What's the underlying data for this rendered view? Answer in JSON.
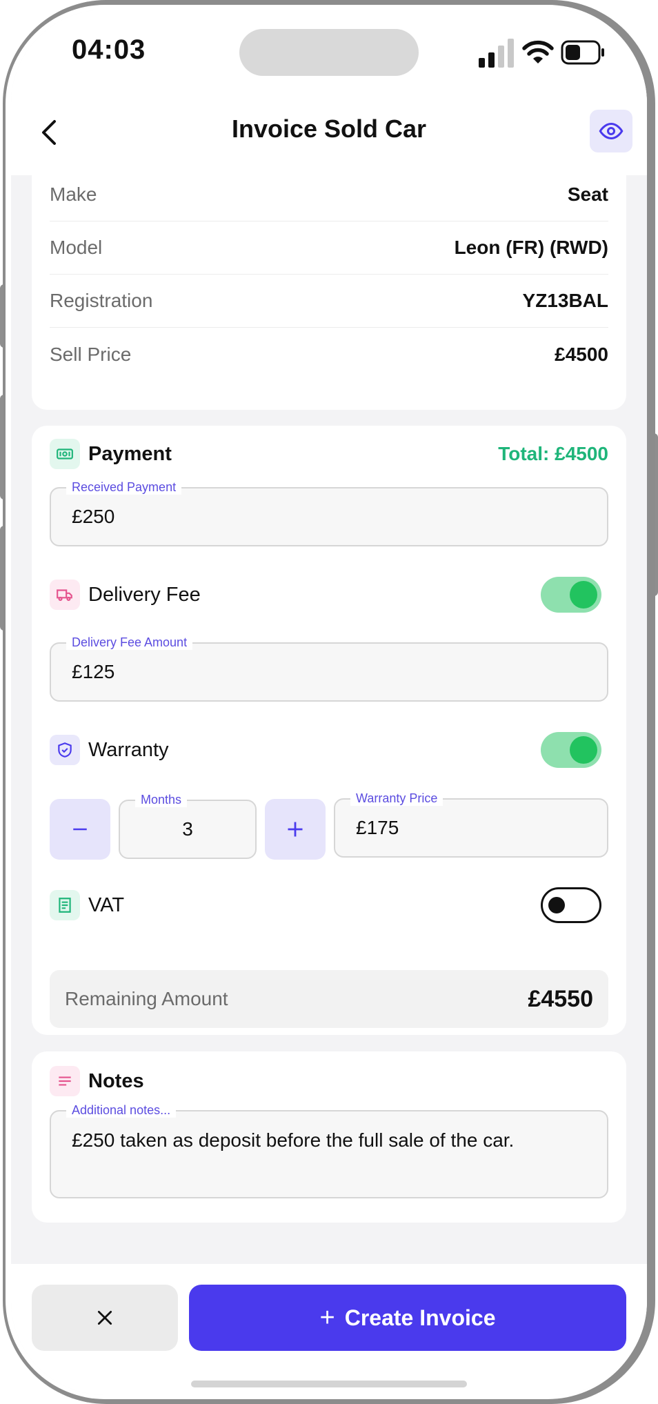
{
  "status_bar": {
    "time": "04:03"
  },
  "header": {
    "title": "Invoice Sold Car"
  },
  "car_info": [
    {
      "label": "Make",
      "value": "Seat"
    },
    {
      "label": "Model",
      "value": "Leon (FR) (RWD)"
    },
    {
      "label": "Registration",
      "value": "YZ13BAL"
    },
    {
      "label": "Sell Price",
      "value": "£4500"
    }
  ],
  "payment": {
    "label": "Payment",
    "total": "Total: £4500",
    "received_label": "Received Payment",
    "received_value": "£250"
  },
  "delivery": {
    "label": "Delivery Fee",
    "enabled": true,
    "amount_label": "Delivery Fee Amount",
    "amount_value": "£125"
  },
  "warranty": {
    "label": "Warranty",
    "enabled": true,
    "months_label": "Months",
    "months_value": "3",
    "decrement": "−",
    "increment": "+",
    "price_label": "Warranty Price",
    "price_value": "£175"
  },
  "vat": {
    "label": "VAT",
    "enabled": false
  },
  "remaining": {
    "label": "Remaining Amount",
    "value": "£4550"
  },
  "notes": {
    "label": "Notes",
    "field_label": "Additional notes...",
    "value": "£250 taken as deposit before the full sale of the car."
  },
  "actions": {
    "cancel_icon": "close-icon",
    "create_label": "Create Invoice",
    "create_icon": "+"
  },
  "colors": {
    "accent": "#4a3aed",
    "accent_soft": "#e6e4fb",
    "total_green": "#1fb57a",
    "toggle_on": "#22c35f",
    "toggle_track_on": "#8ee0ae"
  }
}
